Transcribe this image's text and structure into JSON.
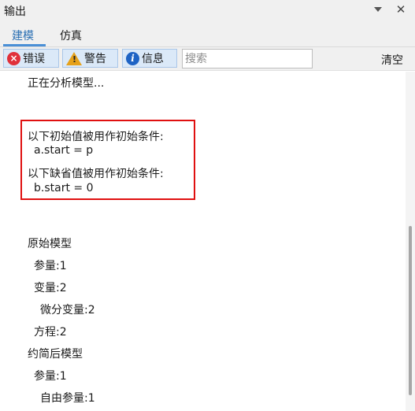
{
  "panel": {
    "title": "输出",
    "close_glyph": "✕"
  },
  "tabs": [
    {
      "label": "建模",
      "active": true
    },
    {
      "label": "仿真",
      "active": false
    }
  ],
  "toolbar": {
    "error_label": "错误",
    "warning_label": "警告",
    "info_label": "信息",
    "search_placeholder": "搜索",
    "search_value": "",
    "clear_label": "清空",
    "error_icon": "close-circle-icon",
    "warning_icon": "warning-triangle-icon",
    "info_icon": "info-circle-icon"
  },
  "log": [
    "正在分析模型...",
    "以下初始值被用作初始条件:",
    "a.start = p",
    "以下缺省值被用作初始条件:",
    "b.start = 0",
    "原始模型",
    "参量:1",
    "变量:2",
    "微分变量:2",
    "方程:2",
    "约简后模型",
    "参量:1",
    "自由参量:1"
  ],
  "colors": {
    "accent": "#2a6fb3",
    "highlight": "#e01010",
    "button_bg": "#dbe9f8"
  }
}
